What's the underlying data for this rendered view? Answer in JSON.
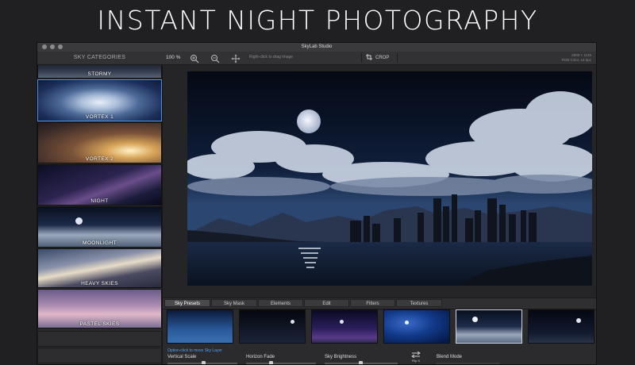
{
  "headline": "INSTANT NIGHT PHOTOGRAPHY",
  "window": {
    "title": "SkyLab Studio"
  },
  "toolbar": {
    "zoom_level": "100 %",
    "hint": "Right-click to drag image",
    "crop_label": "CROP",
    "info_line1": "2500 × 1125",
    "info_line2": "RGB Color, 16 bpc",
    "icons": [
      "zoom-in-icon",
      "zoom-out-icon",
      "move-icon",
      "crop-icon"
    ]
  },
  "sidebar": {
    "header": "SKY CATEGORIES",
    "items": [
      {
        "label": "STORMY",
        "selected": false
      },
      {
        "label": "VORTEX 1",
        "selected": true
      },
      {
        "label": "VORTEX 2",
        "selected": false
      },
      {
        "label": "NIGHT",
        "selected": false
      },
      {
        "label": "MOONLIGHT",
        "selected": false
      },
      {
        "label": "HEAVY SKIES",
        "selected": false
      },
      {
        "label": "PASTEL SKIES",
        "selected": false
      }
    ]
  },
  "tabs": [
    {
      "label": "Sky Presets",
      "active": true
    },
    {
      "label": "Sky Mask",
      "active": false
    },
    {
      "label": "Elements",
      "active": false
    },
    {
      "label": "Edit",
      "active": false
    },
    {
      "label": "Filters",
      "active": false
    },
    {
      "label": "Textures",
      "active": false
    }
  ],
  "presets": {
    "count": 6,
    "selected_index": 4
  },
  "controls": {
    "hint": "Option-click to move Sky Layer",
    "vertical_scale": "Vertical Scale",
    "horizon_fade": "Horizon Fade",
    "sky_brightness": "Sky Brightness",
    "flip_label": "Flip X",
    "blend_mode": "Blend Mode"
  },
  "colors": {
    "accent": "#4a90d9",
    "hint_blue": "#4aa3ff",
    "window_bg": "#2b2b2d"
  }
}
